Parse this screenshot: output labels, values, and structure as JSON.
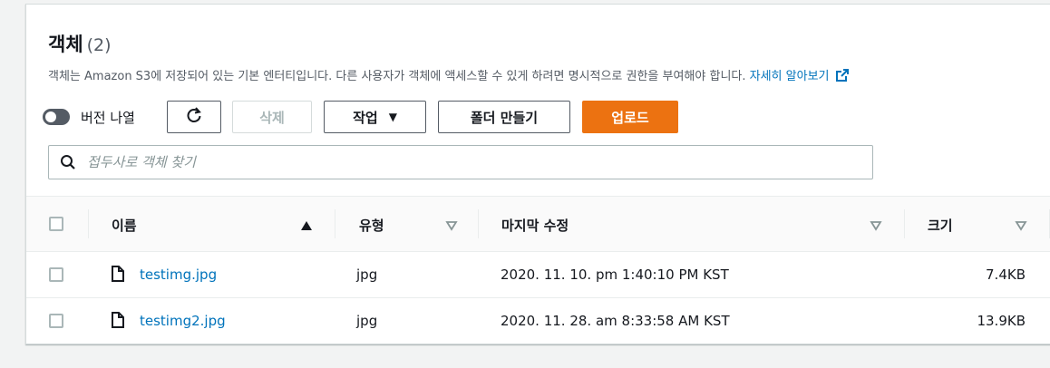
{
  "header": {
    "title": "객체",
    "count": "(2)",
    "description": "객체는 Amazon S3에 저장되어 있는 기본 엔터티입니다. 다른 사용자가 객체에 액세스할 수 있게 하려면 명시적으로 권한을 부여해야 합니다.",
    "learn_more": "자세히 알아보기",
    "learn_more_icon": "external-link-icon"
  },
  "toolbar": {
    "versions_toggle_label": "버전 나열",
    "versions_toggle_on": false,
    "refresh_icon": "refresh-icon",
    "delete_label": "삭제",
    "actions_label": "작업",
    "create_folder_label": "폴더 만들기",
    "upload_label": "업로드"
  },
  "search": {
    "placeholder": "접두사로 객체 찾기",
    "value": ""
  },
  "table": {
    "columns": {
      "name": "이름",
      "type": "유형",
      "modified": "마지막 수정",
      "size": "크기"
    },
    "rows": [
      {
        "name": "testimg.jpg",
        "type": "jpg",
        "modified": "2020. 11. 10. pm 1:40:10 PM KST",
        "size": "7.4KB"
      },
      {
        "name": "testimg2.jpg",
        "type": "jpg",
        "modified": "2020. 11. 28. am 8:33:58 AM KST",
        "size": "13.9KB"
      }
    ]
  },
  "colors": {
    "primary": "#ec7211",
    "link": "#0073bb",
    "text": "#16191f"
  }
}
